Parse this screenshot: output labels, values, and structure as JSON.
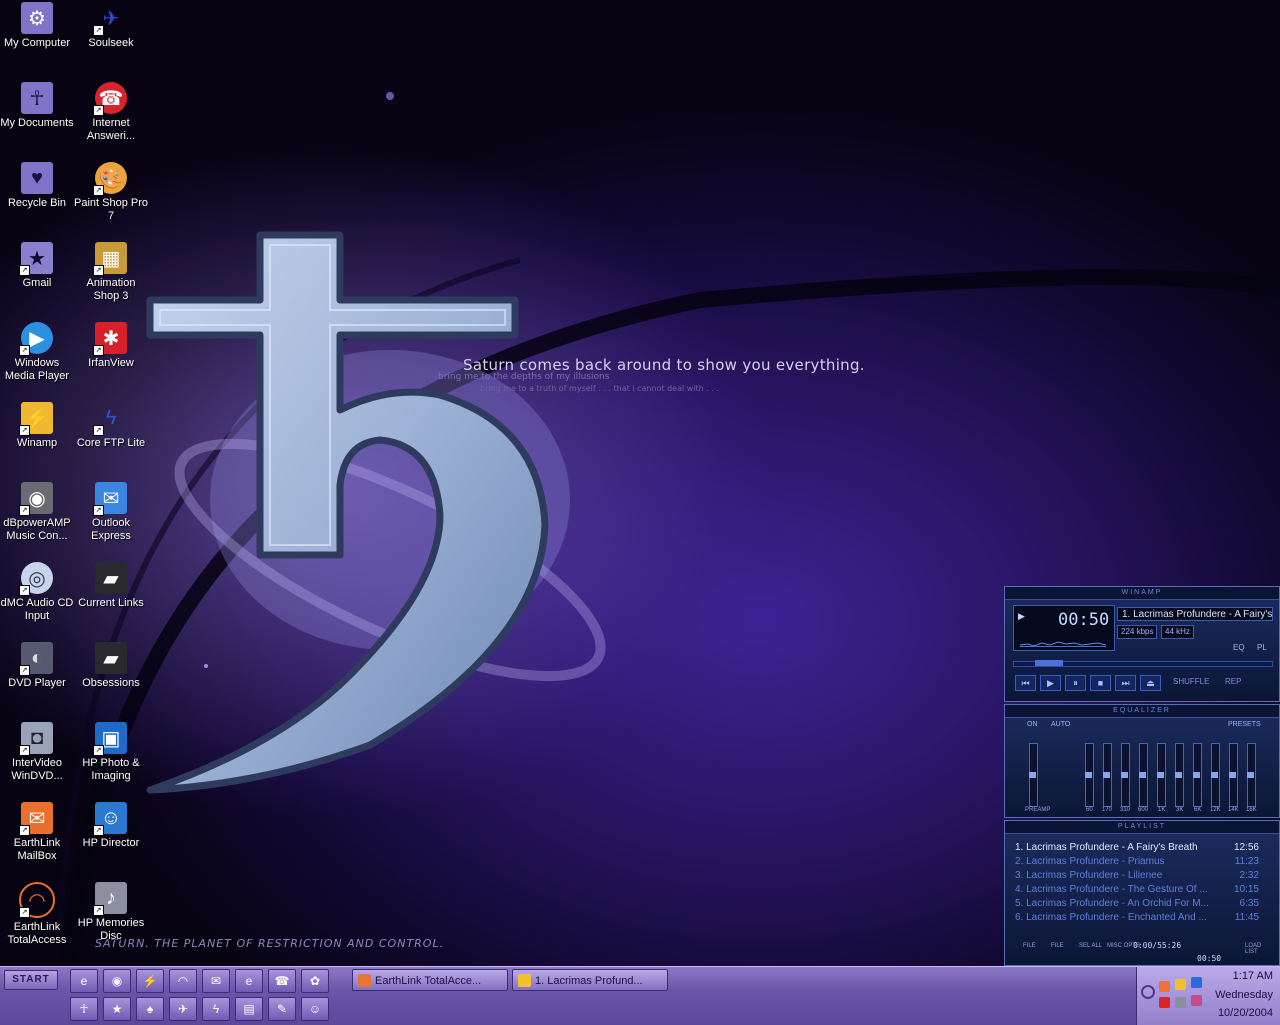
{
  "wallpaper": {
    "tagline": "Saturn comes back around to show you everything.",
    "sub_line_1": "bring me to the depths of my illusions",
    "sub_line_2": "bring me to a truth of myself . . . that i cannot deal with . . .",
    "bottom_caption": "SATURN. THE PLANET OF RESTRICTION AND CONTROL."
  },
  "desktop_icons": [
    {
      "label": "My Computer",
      "icon": "my-computer-icon"
    },
    {
      "label": "Soulseek",
      "icon": "soulseek-bird-icon"
    },
    {
      "label": "My Documents",
      "icon": "ankh-documents-icon"
    },
    {
      "label": "Internet Answeri...",
      "icon": "internet-answering-icon"
    },
    {
      "label": "Recycle Bin",
      "icon": "heart-recycle-icon"
    },
    {
      "label": "Paint Shop Pro 7",
      "icon": "palette-icon"
    },
    {
      "label": "Gmail",
      "icon": "star-icon"
    },
    {
      "label": "Animation Shop 3",
      "icon": "film-icon"
    },
    {
      "label": "Windows Media Player",
      "icon": "media-player-icon"
    },
    {
      "label": "IrfanView",
      "icon": "irfanview-icon"
    },
    {
      "label": "Winamp",
      "icon": "winamp-icon"
    },
    {
      "label": "Core FTP Lite",
      "icon": "lightning-icon"
    },
    {
      "label": "dBpowerAMP Music Con...",
      "icon": "speaker-icon"
    },
    {
      "label": "Outlook Express",
      "icon": "outlook-icon"
    },
    {
      "label": "dMC Audio CD Input",
      "icon": "cd-icon"
    },
    {
      "label": "Current Links",
      "icon": "folder-icon"
    },
    {
      "label": "DVD Player",
      "icon": "dvd-icon"
    },
    {
      "label": "Obsessions",
      "icon": "folder-icon"
    },
    {
      "label": "InterVideo WinDVD...",
      "icon": "camera-icon"
    },
    {
      "label": "HP Photo & Imaging",
      "icon": "hp-photo-icon"
    },
    {
      "label": "EarthLink MailBox",
      "icon": "mailbox-icon"
    },
    {
      "label": "HP Director",
      "icon": "hp-director-icon"
    },
    {
      "label": "EarthLink TotalAccess",
      "icon": "earthlink-icon"
    },
    {
      "label": "HP Memories Disc",
      "icon": "hp-memories-icon"
    }
  ],
  "winamp": {
    "title": "WINAMP",
    "time": "00:50",
    "track": "1. Lacrimas Profundere - A Fairy's Breath",
    "kbps": "224 kbps",
    "khz": "44 kHz",
    "eq_button": "EQ",
    "pl_button": "PL",
    "shuffle": "SHUFFLE",
    "repeat": "REP",
    "seek_fraction": 0.09,
    "equalizer": {
      "title": "EQUALIZER",
      "on": "ON",
      "auto": "AUTO",
      "presets": "PRESETS",
      "preamp_label": "PREAMP",
      "bands": [
        "60",
        "170",
        "310",
        "600",
        "1K",
        "3K",
        "6K",
        "12K",
        "14K",
        "16K"
      ]
    },
    "playlist": {
      "title": "PLAYLIST",
      "items": [
        {
          "title": "1. Lacrimas Profundere - A Fairy's Breath",
          "length": "12:56"
        },
        {
          "title": "2. Lacrimas Profundere - Priamus",
          "length": "11:23"
        },
        {
          "title": "3. Lacrimas Profundere - Lilienee",
          "length": "2:32"
        },
        {
          "title": "4. Lacrimas Profundere - The Gesture Of ...",
          "length": "10:15"
        },
        {
          "title": "5. Lacrimas Profundere - An Orchid For M...",
          "length": "6:35"
        },
        {
          "title": "6. Lacrimas Profundere - Enchanted And ...",
          "length": "11:45"
        }
      ],
      "buttons": [
        "FILE",
        "FILE",
        "SEL ALL",
        "MISC OPTS",
        "LOAD LIST"
      ],
      "total_time": "0:00/55:26",
      "position": "00:50"
    }
  },
  "taskbar": {
    "start_label": "START",
    "tasks": [
      {
        "label": "EarthLink TotalAcce...",
        "color": "#e8743a"
      },
      {
        "label": "1. Lacrimas Profund...",
        "color": "#f0c030"
      }
    ],
    "quick_launch": [
      "ie-icon",
      "media-icon",
      "winamp-icon",
      "earthlink-icon",
      "earthlink-mail-icon",
      "browser-icon",
      "answer-icon",
      "photo-icon",
      "hp-icon",
      "star-icon",
      "spade-icon",
      "soulseek-icon",
      "ftp-icon",
      "doc-icon",
      "paint-icon",
      "hp-director-icon"
    ],
    "clock": {
      "time": "1:17 AM",
      "day": "Wednesday",
      "date": "10/20/2004"
    }
  }
}
